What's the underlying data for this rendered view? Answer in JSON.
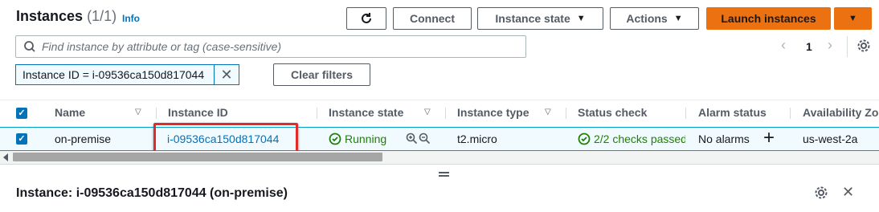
{
  "header": {
    "title": "Instances",
    "count": "(1/1)",
    "info": "Info"
  },
  "toolbar": {
    "connect": "Connect",
    "instance_state": "Instance state",
    "actions": "Actions",
    "launch": "Launch instances"
  },
  "search": {
    "placeholder": "Find instance by attribute or tag (case-sensitive)"
  },
  "filter": {
    "token": "Instance ID = i-09536ca150d817044",
    "clear": "Clear filters"
  },
  "pagination": {
    "page": "1"
  },
  "table": {
    "columns": [
      "Name",
      "Instance ID",
      "Instance state",
      "Instance type",
      "Status check",
      "Alarm status",
      "Availability Zo"
    ],
    "rows": [
      {
        "name": "on-premise",
        "instance_id": "i-09536ca150d817044",
        "state": "Running",
        "type": "t2.micro",
        "status_check": "2/2 checks passed",
        "alarm": "No alarms",
        "zone": "us-west-2a"
      }
    ]
  },
  "details": {
    "title": "Instance: i-09536ca150d817044 (on-premise)"
  },
  "colors": {
    "accent": "#0073bb",
    "launch": "#ec7211",
    "running": "#1d8102",
    "highlight_box": "#e02b2b"
  }
}
